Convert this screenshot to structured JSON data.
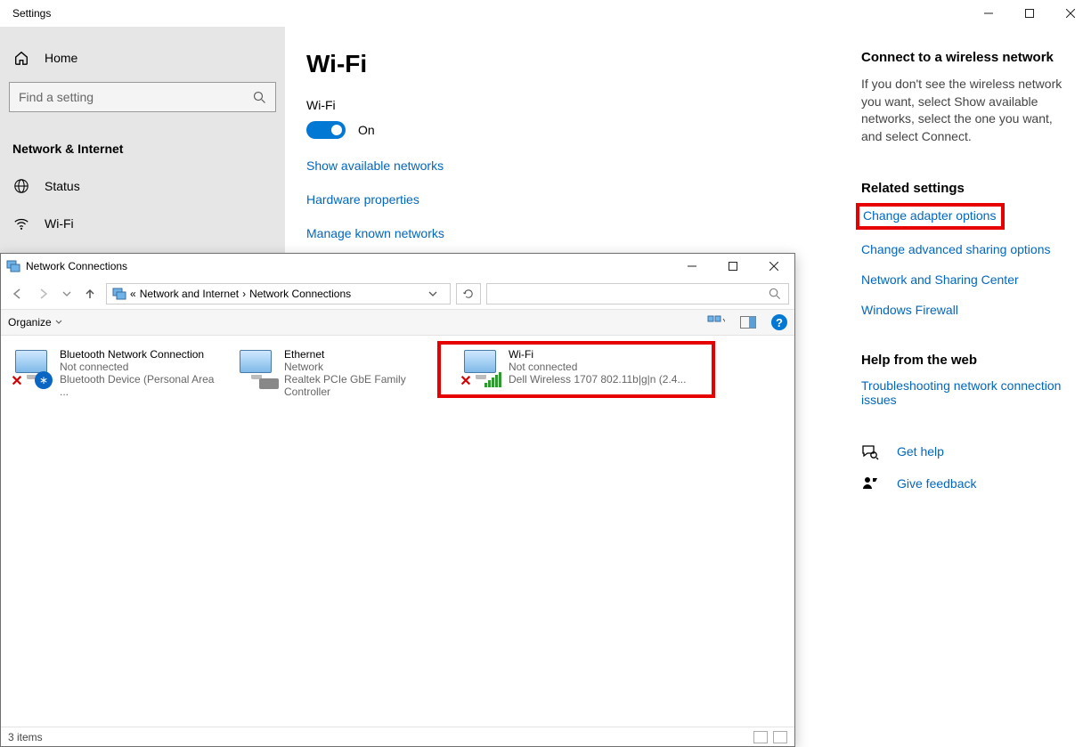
{
  "settings": {
    "window_title": "Settings",
    "home_label": "Home",
    "search_placeholder": "Find a setting",
    "category": "Network & Internet",
    "nav": {
      "status": "Status",
      "wifi": "Wi-Fi"
    },
    "page_title": "Wi-Fi",
    "wifi_section": {
      "label": "Wi-Fi",
      "toggle_state": "On",
      "links": {
        "show_networks": "Show available networks",
        "hardware_props": "Hardware properties",
        "manage_known": "Manage known networks"
      }
    },
    "aside": {
      "connect_heading": "Connect to a wireless network",
      "connect_text": "If you don't see the wireless network you want, select Show available networks, select the one you want, and select Connect.",
      "related_heading": "Related settings",
      "links": {
        "adapter": "Change adapter options",
        "sharing": "Change advanced sharing options",
        "sharing_center": "Network and Sharing Center",
        "firewall": "Windows Firewall"
      },
      "help_heading": "Help from the web",
      "help_link": "Troubleshooting network connection issues",
      "get_help": "Get help",
      "give_feedback": "Give feedback"
    }
  },
  "explorer": {
    "window_title": "Network Connections",
    "breadcrumb_prefix": "«",
    "breadcrumb": [
      "Network and Internet",
      "Network Connections"
    ],
    "organize": "Organize",
    "items": [
      {
        "name": "Bluetooth Network Connection",
        "status": "Not connected",
        "device": "Bluetooth Device (Personal Area ..."
      },
      {
        "name": "Ethernet",
        "status": "Network",
        "device": "Realtek PCIe GbE Family Controller"
      },
      {
        "name": "Wi-Fi",
        "status": "Not connected",
        "device": "Dell Wireless 1707 802.11b|g|n (2.4..."
      }
    ],
    "status_text": "3 items"
  }
}
